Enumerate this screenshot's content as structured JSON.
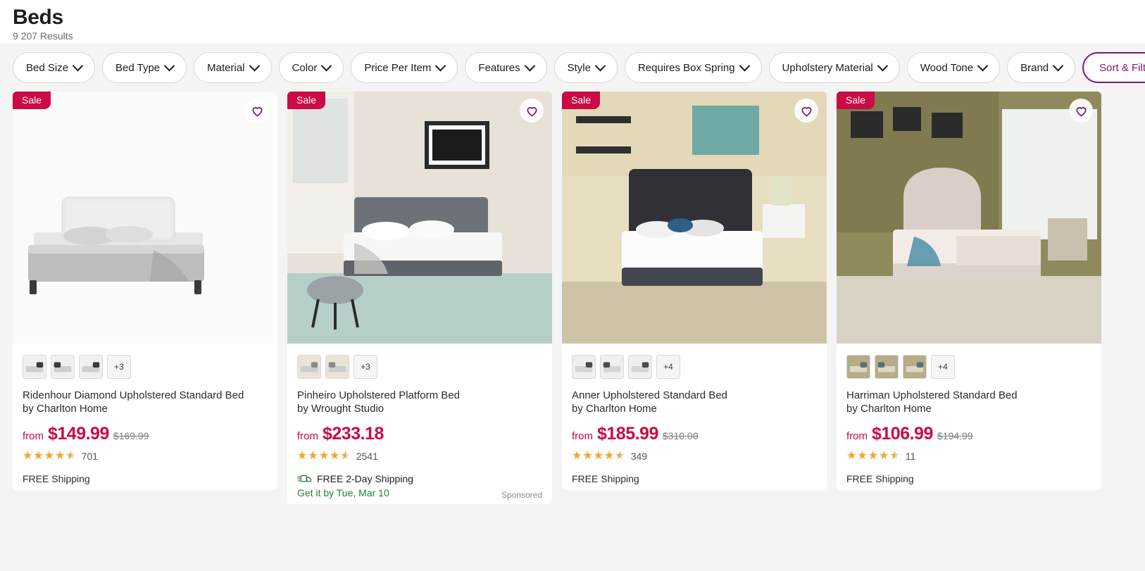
{
  "header": {
    "title": "Beds",
    "results": "9 207 Results"
  },
  "filters": {
    "chips": [
      {
        "label": "Bed Size",
        "icon": "chevron-down-icon"
      },
      {
        "label": "Bed Type",
        "icon": "chevron-down-icon"
      },
      {
        "label": "Material",
        "icon": "chevron-down-icon"
      },
      {
        "label": "Color",
        "icon": "chevron-down-icon"
      },
      {
        "label": "Price Per Item",
        "icon": "chevron-down-icon"
      },
      {
        "label": "Features",
        "icon": "chevron-down-icon"
      },
      {
        "label": "Style",
        "icon": "chevron-down-icon"
      },
      {
        "label": "Requires Box Spring",
        "icon": "chevron-down-icon"
      },
      {
        "label": "Upholstery Material",
        "icon": "chevron-down-icon"
      },
      {
        "label": "Wood Tone",
        "icon": "chevron-down-icon"
      },
      {
        "label": "Brand",
        "icon": "chevron-down-icon"
      }
    ],
    "sort_filter_label": "Sort & Filter"
  },
  "colors": {
    "accent_purple": "#7b187b",
    "sale_red": "#cc0a44",
    "star_gold": "#f5a623",
    "shipping_green": "#237a3e",
    "page_bg": "#f4f4f4"
  },
  "products": [
    {
      "badge": "Sale",
      "favorite_icon": "heart-icon",
      "thumbnails": 3,
      "more_thumbnails": "+3",
      "name": "Ridenhour Diamond Upholstered Standard Bed",
      "brand_line": "by Charlton Home",
      "price_prefix": "from",
      "price": "$149.99",
      "price_was": "$169.99",
      "rating": 4.5,
      "review_count": "701",
      "shipping": "FREE Shipping",
      "shipping_icon": null,
      "delivery_eta": null,
      "sponsored": null
    },
    {
      "badge": "Sale",
      "favorite_icon": "heart-icon",
      "thumbnails": 2,
      "more_thumbnails": "+3",
      "name": "Pinheiro Upholstered Platform Bed",
      "brand_line": "by Wrought Studio",
      "price_prefix": "from",
      "price": "$233.18",
      "price_was": null,
      "rating": 4.5,
      "review_count": "2541",
      "shipping": "FREE 2-Day Shipping",
      "shipping_icon": "truck-icon",
      "delivery_eta": "Get it by Tue, Mar 10",
      "sponsored": "Sponsored"
    },
    {
      "badge": "Sale",
      "favorite_icon": "heart-icon",
      "thumbnails": 3,
      "more_thumbnails": "+4",
      "name": "Anner Upholstered Standard Bed",
      "brand_line": "by Charlton Home",
      "price_prefix": "from",
      "price": "$185.99",
      "price_was": "$310.00",
      "rating": 4.5,
      "review_count": "349",
      "shipping": "FREE Shipping",
      "shipping_icon": null,
      "delivery_eta": null,
      "sponsored": null
    },
    {
      "badge": "Sale",
      "favorite_icon": "heart-icon",
      "thumbnails": 3,
      "more_thumbnails": "+4",
      "name": "Harriman Upholstered Standard Bed",
      "brand_line": "by Charlton Home",
      "price_prefix": "from",
      "price": "$106.99",
      "price_was": "$194.99",
      "rating": 4.5,
      "review_count": "11",
      "shipping": "FREE Shipping",
      "shipping_icon": null,
      "delivery_eta": null,
      "sponsored": null
    }
  ]
}
